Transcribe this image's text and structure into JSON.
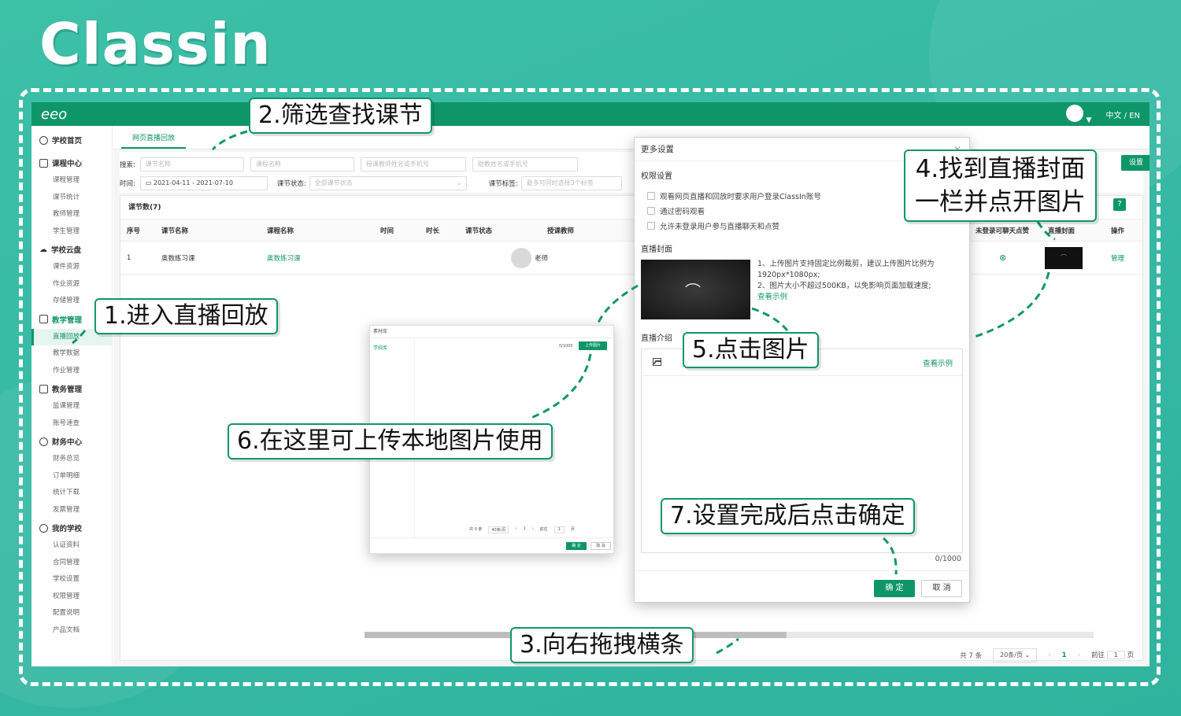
{
  "logo_text": "Classin",
  "app": {
    "brand": "eeo",
    "lang_toggle": "中文 / EN"
  },
  "sidebar": {
    "groups": [
      {
        "label": "学校首页",
        "items": []
      },
      {
        "label": "课程中心",
        "items": [
          "课程管理",
          "课节统计",
          "教师管理",
          "学生管理"
        ]
      },
      {
        "label": "学校云盘",
        "items": [
          "课件资源",
          "作业资源",
          "存储管理"
        ]
      },
      {
        "label": "教学管理",
        "items": [
          "直播回放",
          "教学数据",
          "作业管理"
        ]
      },
      {
        "label": "教务管理",
        "items": [
          "监课管理",
          "账号速查"
        ]
      },
      {
        "label": "财务中心",
        "items": [
          "财务总览",
          "订单明细",
          "统计下载",
          "发票管理"
        ]
      },
      {
        "label": "我的学校",
        "items": [
          "认证资料",
          "合同管理",
          "学校设置",
          "权限管理",
          "配置说明",
          "产品文档"
        ]
      }
    ],
    "active_item": "直播回放"
  },
  "main": {
    "tab": "网页直播回放",
    "filters": {
      "search_label": "搜索:",
      "lesson_name_ph": "课节名称",
      "course_name_ph": "课程名称",
      "teacher_ph": "授课教师姓名或手机号",
      "assistant_ph": "助教姓名或手机号",
      "time_label": "时间:",
      "date_range": "2021-04-11 - 2021-07-10",
      "status_label": "课节状态:",
      "status_ph": "全部课节状态",
      "tag_label": "课节标签:",
      "tag_ph": "最多可同时选择3个标签"
    },
    "count_label": "课节数(7)",
    "headers": [
      "序号",
      "课节名称",
      "课程名称",
      "时间",
      "时长",
      "课节状态",
      "授课教师",
      "未登录可聊天点赞",
      "直播封面",
      "操作"
    ],
    "row": {
      "index": "1",
      "lesson": "奥数练习课",
      "course": "奥数练习课",
      "teacher": "老师",
      "action": "管理"
    },
    "side_btn": "设置",
    "pager": {
      "total": "共 7 条",
      "per_page": "20条/页",
      "current": "1",
      "goto": "前往",
      "goto_val": "1",
      "page_unit": "页"
    }
  },
  "materials": {
    "title": "素材库",
    "side_item": "学校库",
    "count": "0/1000",
    "upload": "上传图片",
    "pager_total": "共 0 条",
    "pager_size": "40条/页",
    "pager_cur": "1",
    "goto": "前往",
    "goto_val": "1",
    "page_unit": "页",
    "ok": "确 定",
    "cancel": "取 消"
  },
  "more_settings": {
    "title": "更多设置",
    "perm_label": "权限设置",
    "options": [
      "观看网页直播和回放时要求用户登录ClassIn账号",
      "通过密码观看",
      "允许未登录用户参与直播聊天和点赞"
    ],
    "cover_label": "直播封面",
    "cover_note1": "1、上传图片支持固定比例裁剪，建议上传图片比例为1920px*1080px;",
    "cover_note2": "2、图片大小不超过500KB，以免影响页面加载速度;",
    "cover_example": "查看示例",
    "intro_label": "直播介绍",
    "editor_example": "查看示例",
    "char_count": "0/1000",
    "ok": "确 定",
    "cancel": "取 消"
  },
  "callouts": {
    "c1": "1.进入直播回放",
    "c2": "2.筛选查找课节",
    "c3": "3.向右拖拽横条",
    "c4_line1": "4.找到直播封面",
    "c4_line2": "一栏并点开图片",
    "c5": "5.点击图片",
    "c6": "6.在这里可上传本地图片使用",
    "c7": "7.设置完成后点击确定"
  },
  "colors": {
    "brand_green": "#0f9668",
    "background": "#3cc0a6"
  }
}
